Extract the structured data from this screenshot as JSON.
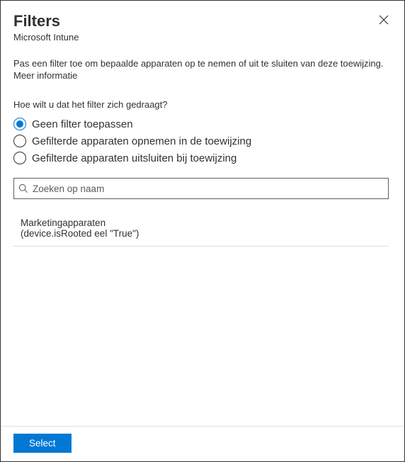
{
  "header": {
    "title": "Filters",
    "subtitle": "Microsoft Intune"
  },
  "description": "Pas een filter toe om bepaalde apparaten op te nemen of uit te sluiten van deze toewijzing.",
  "more_info": "Meer informatie",
  "question": "Hoe wilt u dat het filter zich gedraagt?",
  "radio": {
    "options": [
      {
        "label": "Geen filter toepassen",
        "selected": true
      },
      {
        "label": "Gefilterde apparaten opnemen in de toewijzing",
        "selected": false
      },
      {
        "label": "Gefilterde apparaten uitsluiten bij toewijzing",
        "selected": false
      }
    ]
  },
  "search": {
    "placeholder": "Zoeken op naam",
    "value": ""
  },
  "results": [
    {
      "name": "Marketingapparaten",
      "detail": "(device.isRooted eel \"True\")"
    }
  ],
  "footer": {
    "select_label": "Select"
  }
}
